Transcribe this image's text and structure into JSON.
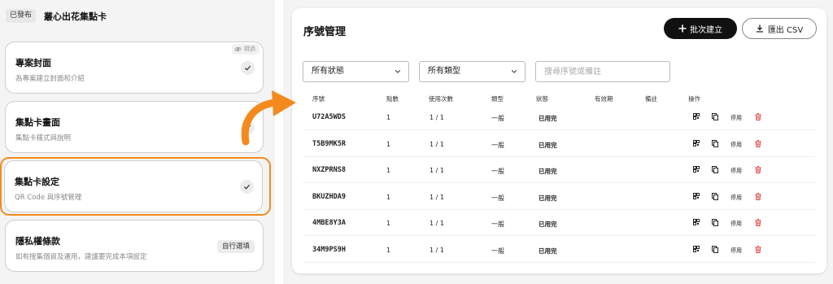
{
  "project": {
    "status": "已發布",
    "title": "叢心出花集點卡"
  },
  "steps": [
    {
      "title": "專案封面",
      "desc": "為專案建立封面和介紹",
      "badge": "跳過"
    },
    {
      "title": "集點卡畫面",
      "desc": "集點卡樣式與說明"
    },
    {
      "title": "集點卡設定",
      "desc": "QR Code 與序號管理"
    },
    {
      "title": "隱私權條款",
      "desc": "如有搜集個資及運用，建議要完成本項設定",
      "action": "自行選填"
    }
  ],
  "serials": {
    "title": "序號管理",
    "batch_button": "批次建立",
    "export_button": "匯出 CSV",
    "filter_status": "所有狀態",
    "filter_type": "所有類型",
    "search_placeholder": "搜尋序號或備註",
    "columns": [
      "序號",
      "點數",
      "使用次數",
      "類型",
      "狀態",
      "有效期",
      "備註",
      "操作"
    ],
    "disable_label": "停用",
    "rows": [
      {
        "code": "U72A5WDS",
        "points": "1",
        "usage": "1 / 1",
        "type": "一般",
        "status": "已用完"
      },
      {
        "code": "T5B9MK5R",
        "points": "1",
        "usage": "1 / 1",
        "type": "一般",
        "status": "已用完"
      },
      {
        "code": "NXZPRNS8",
        "points": "1",
        "usage": "1 / 1",
        "type": "一般",
        "status": "已用完"
      },
      {
        "code": "BKUZHDA9",
        "points": "1",
        "usage": "1 / 1",
        "type": "一般",
        "status": "已用完"
      },
      {
        "code": "4MBE8Y3A",
        "points": "1",
        "usage": "1 / 1",
        "type": "一般",
        "status": "已用完"
      },
      {
        "code": "34M9PS9H",
        "points": "1",
        "usage": "1 / 1",
        "type": "一般",
        "status": "已用完"
      }
    ]
  },
  "colors": {
    "accent_orange": "#f48a1d",
    "delete_red": "#d93636",
    "primary_dark": "#111111"
  },
  "icons": {
    "arrow": "curved-arrow-icon",
    "check": "check-icon",
    "hidden": "eye-off-icon",
    "plus": "plus-icon",
    "download": "download-icon",
    "qr": "qr-code-icon",
    "copy": "copy-icon",
    "delete": "trash-icon"
  }
}
